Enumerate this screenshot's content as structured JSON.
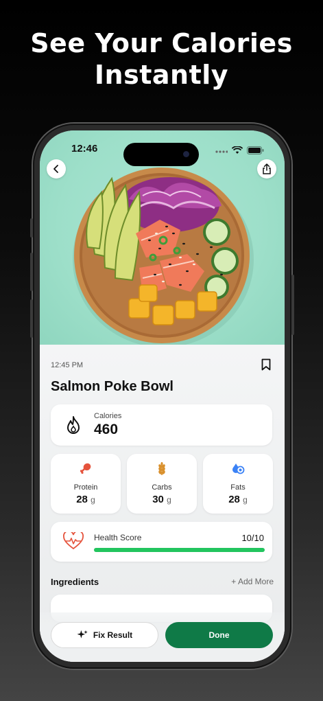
{
  "headline": {
    "line1": "See Your Calories",
    "line2": "Instantly"
  },
  "status_bar": {
    "time": "12:46"
  },
  "meal": {
    "timestamp": "12:45 PM",
    "name": "Salmon Poke Bowl",
    "image_description": "salmon poke bowl with avocado, red cabbage, cucumber, mango and sesame"
  },
  "calories": {
    "label": "Calories",
    "value": "460",
    "icon": "flame-icon"
  },
  "macros": [
    {
      "label": "Protein",
      "value": "28",
      "unit": "g",
      "icon": "drumstick-icon",
      "color": "#e5533c"
    },
    {
      "label": "Carbs",
      "value": "30",
      "unit": "g",
      "icon": "wheat-icon",
      "color": "#d9902c"
    },
    {
      "label": "Fats",
      "value": "28",
      "unit": "g",
      "icon": "oil-drop-icon",
      "color": "#3b82f6"
    }
  ],
  "health": {
    "label": "Health Score",
    "score": "10/10",
    "fraction": 1.0,
    "color": "#22c55e"
  },
  "ingredients": {
    "title": "Ingredients",
    "add_more": "+ Add More"
  },
  "actions": {
    "fix_label": "Fix Result",
    "done_label": "Done"
  },
  "colors": {
    "accent": "#0f7a47",
    "hero_bg": "#9ddfc9"
  }
}
